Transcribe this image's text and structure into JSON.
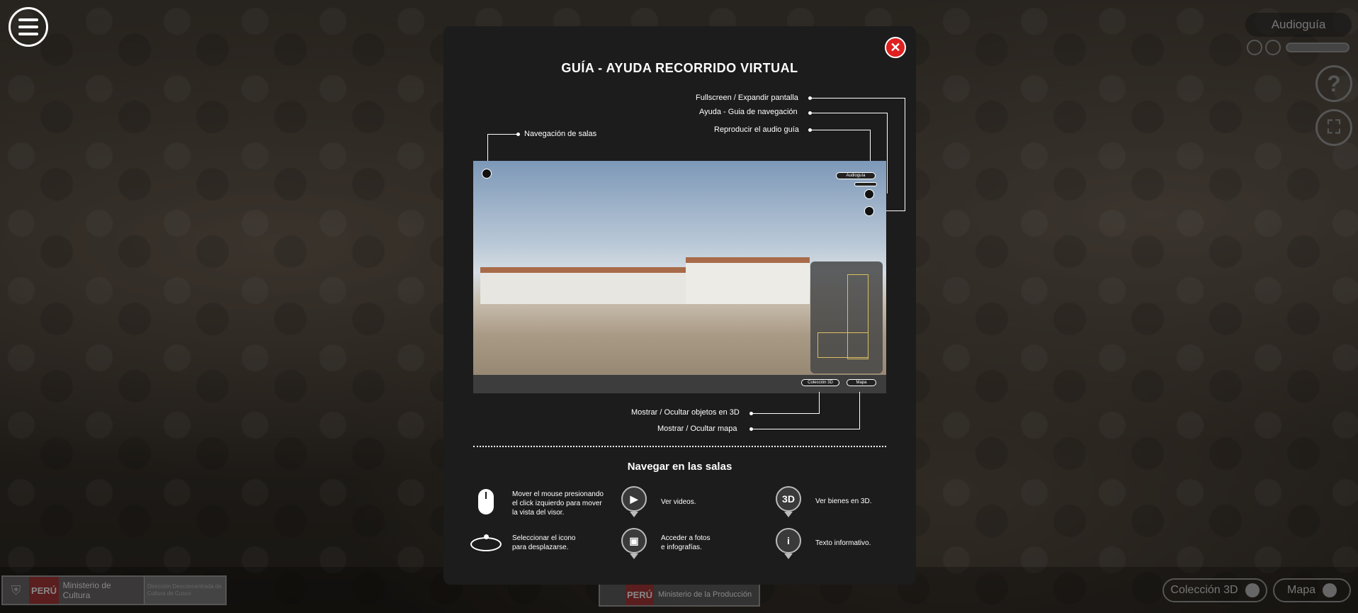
{
  "modal": {
    "title": "GUÍA - AYUDA RECORRIDO VIRTUAL",
    "close_label": "✕",
    "callouts": {
      "fullscreen": "Fullscreen / Expandir pantalla",
      "help": "Ayuda - Guia de navegación",
      "audio": "Reproducir el audio guía",
      "rooms_nav": "Navegación de salas",
      "toggle_3d": "Mostrar / Ocultar objetos en 3D",
      "toggle_map": "Mostrar / Ocultar mapa"
    },
    "preview": {
      "audio_pill": "Audioguía",
      "coleccion_pill": "Colección 3D",
      "mapa_pill": "Mapa"
    },
    "section_title": "Navegar en las salas",
    "items": {
      "mouse": "Mover el mouse presionando el click izquierdo para mover la vista del visor.",
      "select": "Seleccionar el icono para desplazarse.",
      "videos": "Ver videos.",
      "photos": "Acceder a fotos e infografías.",
      "3d": "Ver bienes en 3D.",
      "info": "Texto informativo."
    },
    "pin_labels": {
      "threed": "3D",
      "info": "i"
    }
  },
  "hud": {
    "audio_label": "Audioguía",
    "help_glyph": "?",
    "fullscreen_glyph": "⛶",
    "coleccion_label": "Colección 3D",
    "mapa_label": "Mapa"
  },
  "footer": {
    "left_peru": "PERÚ",
    "left_ministry": "Ministerio de Cultura",
    "left_direction": "Dirección Desconcentrada de Cultura de Cusco",
    "center_peru": "PERÚ",
    "center_ministry": "Ministerio de la Producción"
  }
}
